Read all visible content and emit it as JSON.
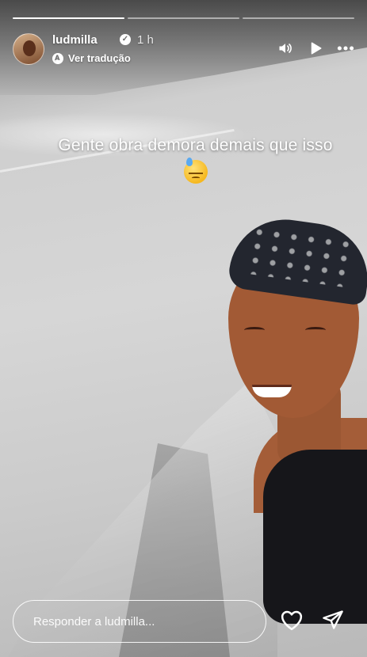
{
  "progress": {
    "segments": [
      {
        "state": "viewed",
        "fill": 1.0
      },
      {
        "state": "current",
        "fill": 0.0
      },
      {
        "state": "upcoming",
        "fill": 0.0
      }
    ]
  },
  "header": {
    "username": "ludmilla",
    "verified_icon": "verified-badge-icon",
    "time_ago": "1 h",
    "translate_label": "Ver tradução"
  },
  "controls": {
    "icons": [
      "volume-icon",
      "play-icon",
      "more-icon"
    ]
  },
  "story": {
    "caption": "Gente obra demora demais que isso",
    "emoji": "downcast-face-with-sweat"
  },
  "reply": {
    "placeholder": "Responder a ludmilla..."
  },
  "bottom_actions": {
    "icons": [
      "heart-icon",
      "send-icon"
    ]
  },
  "colors": {
    "text": "#ffffff",
    "bandana": "#23262f",
    "top": "#16161a"
  }
}
